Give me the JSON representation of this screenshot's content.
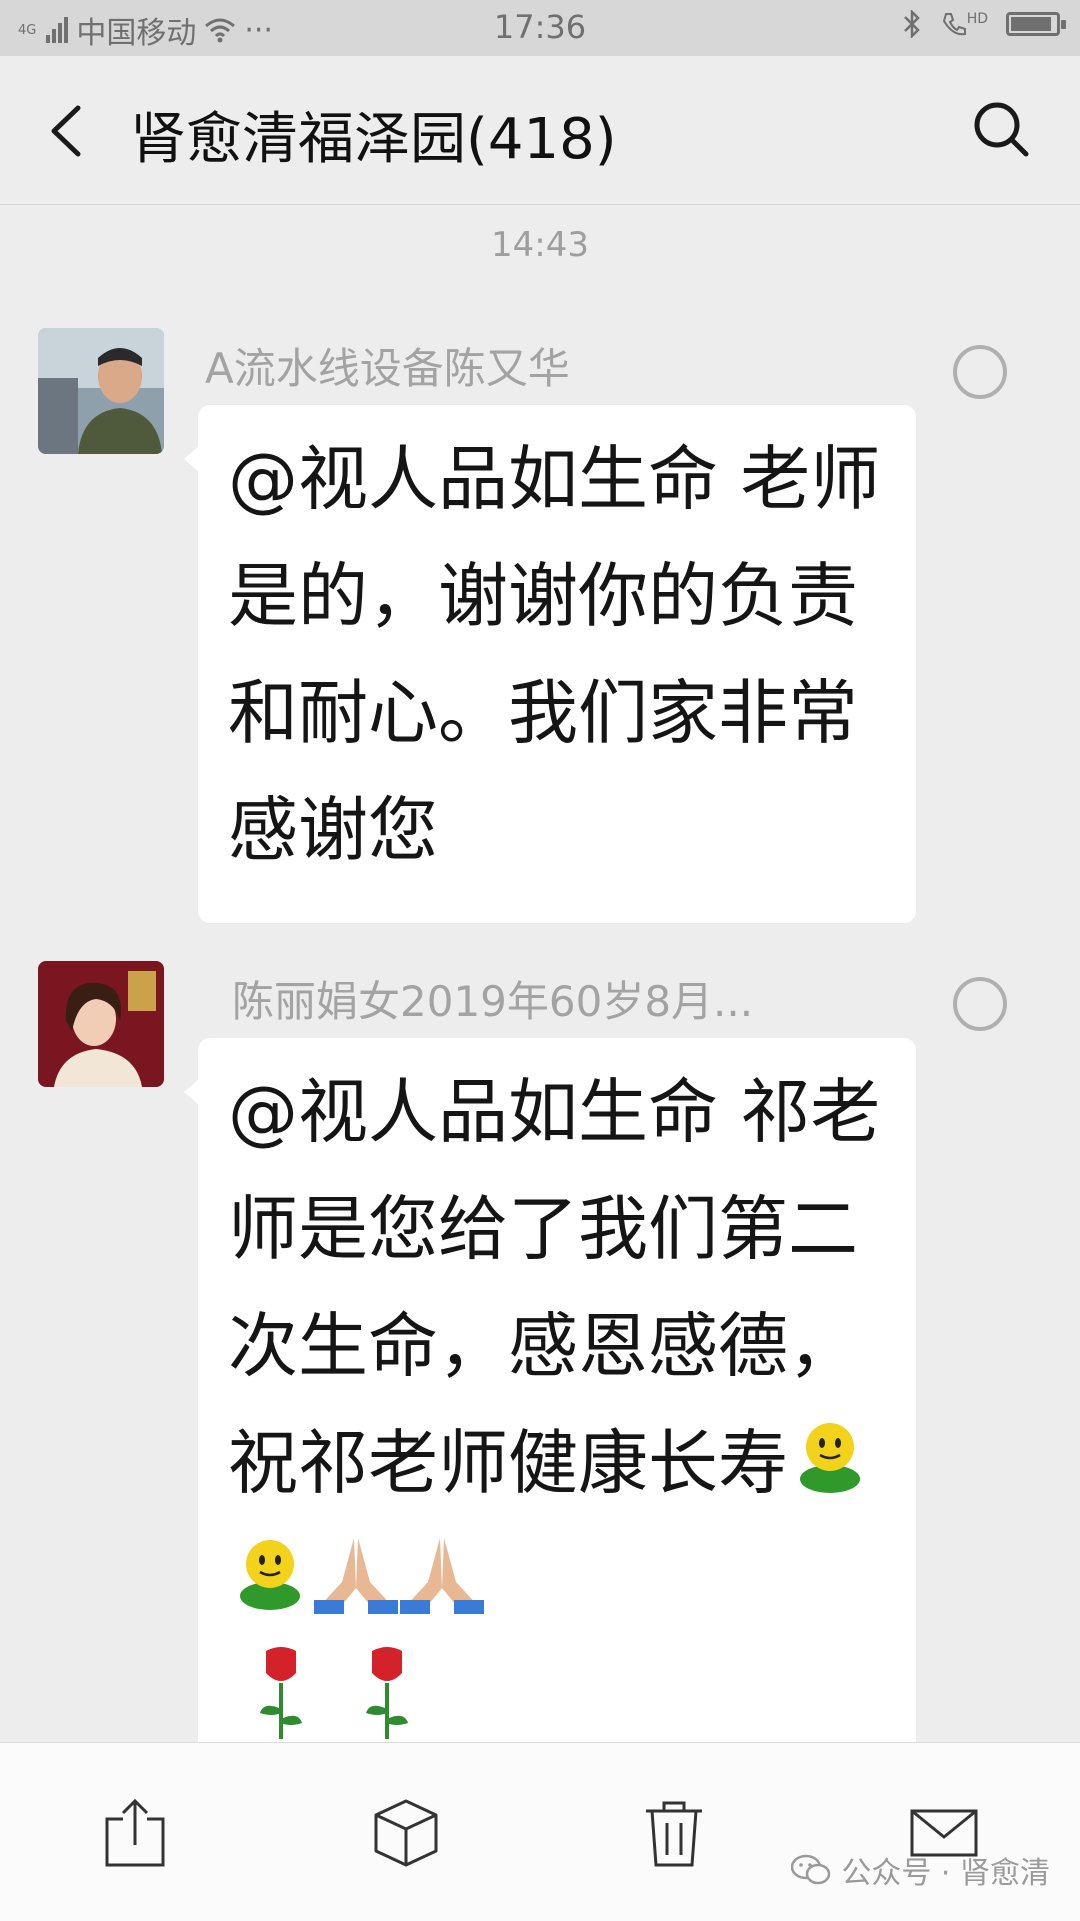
{
  "status_bar": {
    "signal_label": "4G",
    "carrier": "中国移动",
    "extra": "···",
    "time": "17:36",
    "hd_label": "HD",
    "battery_level": 0.92
  },
  "nav": {
    "title": "肾愈清福泽园(418)"
  },
  "timestamp": "14:43",
  "messages": [
    {
      "sender": "A流水线设备陈又华",
      "text": "@视人品如生命 老师是的，谢谢你的负责和耐心。我们家非常感谢您"
    },
    {
      "sender": "陈丽娟女2019年60岁8月...",
      "text": "@视人品如生命 祁老师是您给了我们第二次生命，感恩感德，祝祁老师健康长寿"
    }
  ],
  "toolbar": {
    "items": [
      "share-icon",
      "box-icon",
      "trash-icon",
      "mail-icon"
    ]
  },
  "watermark": "公众号 · 肾愈清",
  "colors": {
    "background": "#ededed",
    "bubble": "#ffffff",
    "text": "#151515",
    "secondary": "#a3a3a3"
  }
}
